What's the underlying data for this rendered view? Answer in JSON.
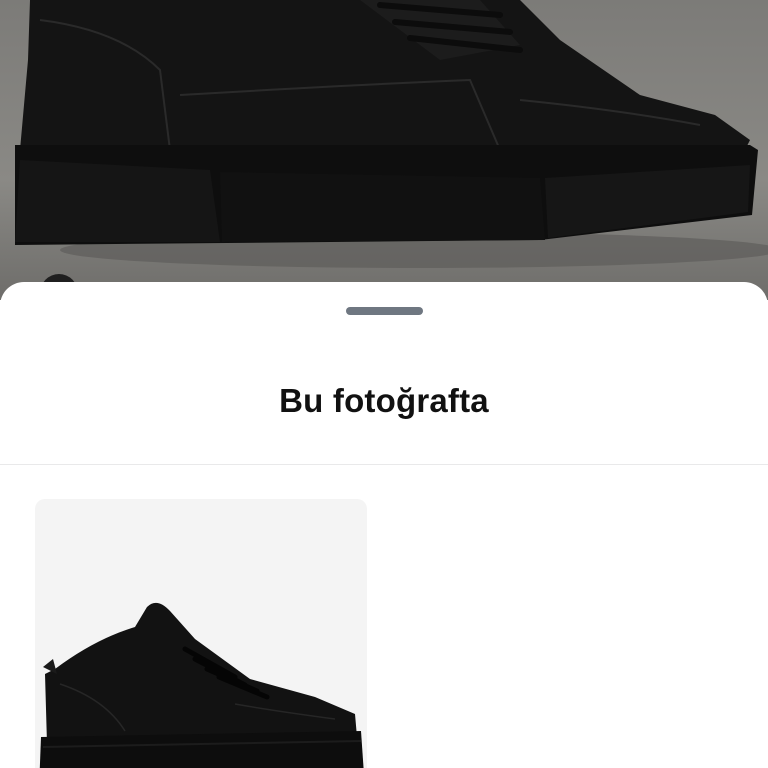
{
  "sheet": {
    "title": "Bu fotoğrafta"
  },
  "icons": {
    "grabber": "drag-handle-icon"
  },
  "colors": {
    "sheet_background": "#ffffff",
    "title_text": "#111111",
    "grabber": "#6f7781",
    "card_background": "#f4f4f4"
  }
}
